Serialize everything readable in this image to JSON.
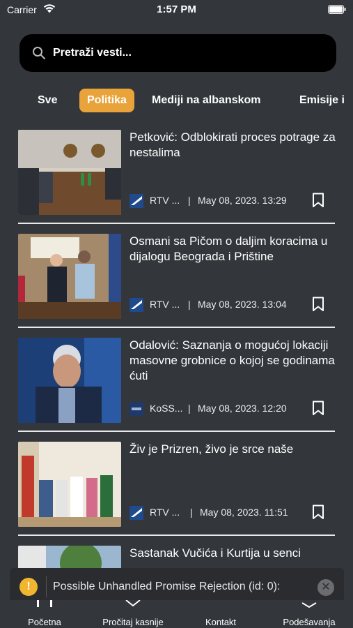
{
  "status_bar": {
    "carrier": "Carrier",
    "time": "1:57 PM"
  },
  "search": {
    "placeholder": "Pretraži vesti..."
  },
  "tabs": [
    {
      "label": "Sve",
      "active": false
    },
    {
      "label": "Politika",
      "active": true
    },
    {
      "label": "Mediji na albanskom",
      "active": false
    },
    {
      "label": "Emisije i",
      "active": false
    }
  ],
  "colors": {
    "accent": "#e8a33a",
    "background": "#33363b",
    "search_bg": "#000000"
  },
  "news": [
    {
      "title": "Petković: Odblokirati proces potrage za nestalima",
      "source": "RTV ...",
      "separator": "|",
      "date": "May 08, 2023. 13:29",
      "source_icon": "rtv-logo-icon"
    },
    {
      "title": "Osmani sa Pičom o daljim koracima u dijalogu Beograda i Prištine",
      "source": "RTV ...",
      "separator": "|",
      "date": "May 08, 2023. 13:04",
      "source_icon": "rtv-logo-icon"
    },
    {
      "title": "Odalović: Saznanja o mogućoj lokaciji masovne grobnice o kojoj se godinama ćuti",
      "source": "KoSS...",
      "separator": "|",
      "date": "May 08, 2023. 12:20",
      "source_icon": "koss-logo-icon"
    },
    {
      "title": "Živ je Prizren, živo je srce naše",
      "source": "RTV ...",
      "separator": "|",
      "date": "May 08, 2023. 11:51",
      "source_icon": "rtv-logo-icon"
    },
    {
      "title": "Sastanak Vučića i Kurtija u senci",
      "source": "",
      "separator": "",
      "date": "",
      "source_icon": ""
    }
  ],
  "toast": {
    "message": "Possible Unhandled Promise Rejection (id: 0):",
    "warning_glyph": "!",
    "close_glyph": "✕"
  },
  "bottom_nav": [
    {
      "label": "Početna"
    },
    {
      "label": "Pročitaj kasnije"
    },
    {
      "label": "Kontakt"
    },
    {
      "label": "Podešavanja"
    }
  ]
}
